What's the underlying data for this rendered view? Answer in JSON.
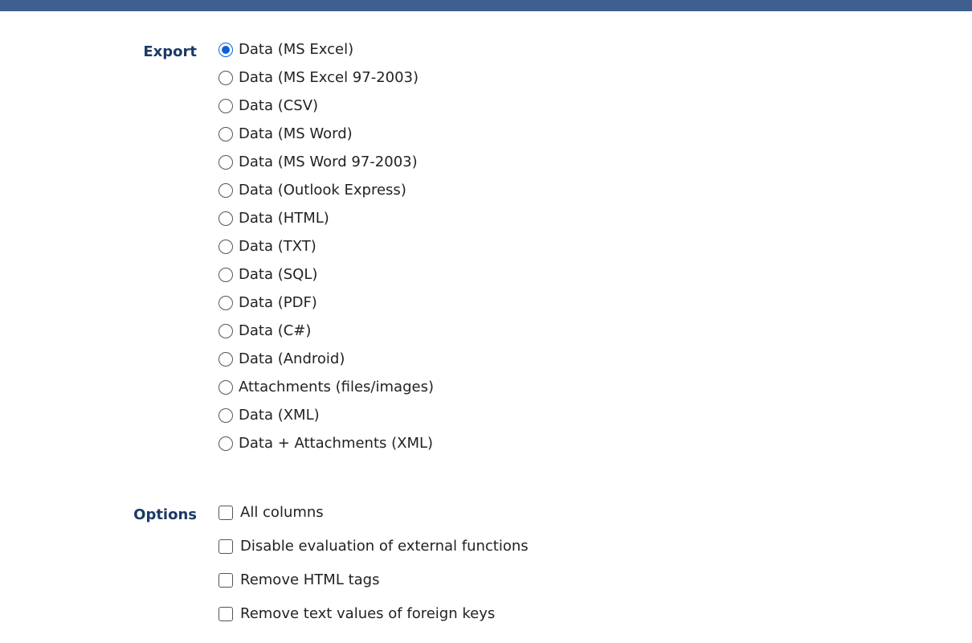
{
  "export": {
    "label": "Export",
    "selected_index": 0,
    "options": [
      "Data (MS Excel)",
      "Data (MS Excel 97-2003)",
      "Data (CSV)",
      "Data (MS Word)",
      "Data (MS Word 97-2003)",
      "Data (Outlook Express)",
      "Data (HTML)",
      "Data (TXT)",
      "Data (SQL)",
      "Data (PDF)",
      "Data (C#)",
      "Data (Android)",
      "Attachments (files/images)",
      "Data (XML)",
      "Data + Attachments (XML)"
    ]
  },
  "options": {
    "label": "Options",
    "items": [
      {
        "label": "All columns",
        "checked": false
      },
      {
        "label": "Disable evaluation of external functions",
        "checked": false
      },
      {
        "label": "Remove HTML tags",
        "checked": false
      },
      {
        "label": "Remove text values of foreign keys",
        "checked": false
      }
    ]
  },
  "colors": {
    "header_bar": "#3f5f8f",
    "label_text": "#1c3a66",
    "radio_selected": "#0b62d6"
  }
}
